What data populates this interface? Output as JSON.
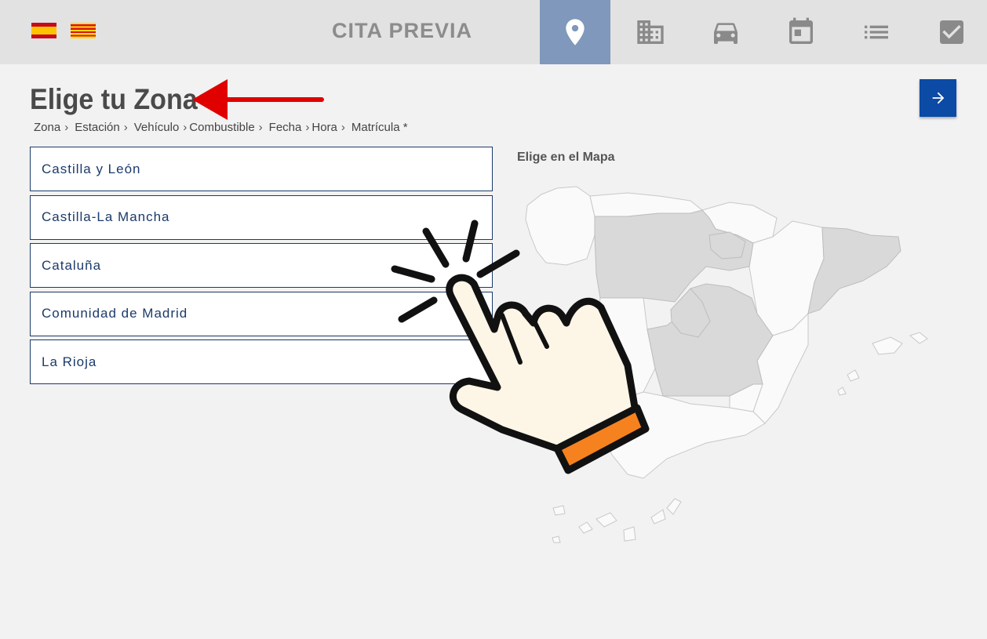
{
  "header": {
    "title": "CITA PREVIA",
    "languages": [
      {
        "icon": "spain-flag-icon",
        "colors": [
          "#c60b1e",
          "#ffc400"
        ]
      },
      {
        "icon": "catalonia-flag-icon",
        "colors": [
          "#fcdd09",
          "#da121a"
        ]
      }
    ],
    "steps": [
      {
        "icon": "location-pin-icon",
        "active": true
      },
      {
        "icon": "building-icon",
        "active": false
      },
      {
        "icon": "car-icon",
        "active": false
      },
      {
        "icon": "calendar-icon",
        "active": false
      },
      {
        "icon": "list-icon",
        "active": false
      },
      {
        "icon": "checkbox-icon",
        "active": false
      }
    ]
  },
  "main": {
    "title": "Elige tu Zona",
    "breadcrumb": [
      "Zona",
      "Estación",
      "Vehículo",
      "Combustible",
      "Fecha",
      "Hora",
      "Matrícula *"
    ],
    "zones": [
      "Castilla y León",
      "Castilla-La Mancha",
      "Cataluña",
      "Comunidad de Madrid",
      "La Rioja"
    ],
    "map_label": "Elige en el Mapa",
    "next_icon": "arrow-right-icon"
  },
  "colors": {
    "accent": "#0b4aa5",
    "active_step": "#7f98bb",
    "zone_text": "#1b3a6b",
    "highlight_region": "#d9d9d9",
    "annotation_arrow": "#e00000",
    "hand_cuff": "#f5821f"
  }
}
